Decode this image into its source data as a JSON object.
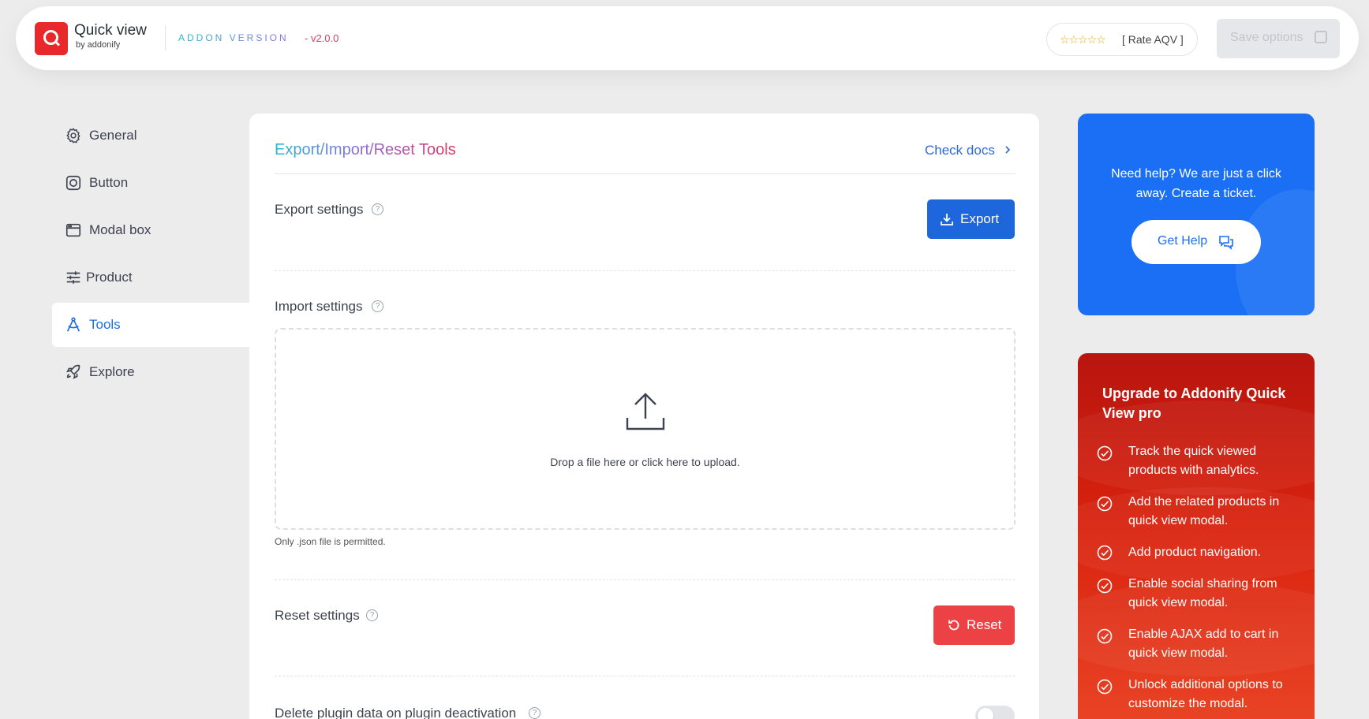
{
  "header": {
    "brand_title": "Quick view",
    "brand_sub": "by addonify",
    "addon_version_label": "ADDON VERSION",
    "version": "- v2.0.0",
    "rate_stars": "☆☆☆☆☆",
    "rate_label": "[ Rate AQV ]",
    "save_label": "Save options"
  },
  "sidebar": {
    "items": [
      {
        "label": "General",
        "icon": "gear-icon",
        "active": false
      },
      {
        "label": "Button",
        "icon": "button-icon",
        "active": false
      },
      {
        "label": "Modal box",
        "icon": "window-icon",
        "active": false
      },
      {
        "label": "Product",
        "icon": "sliders-icon",
        "active": false
      },
      {
        "label": "Tools",
        "icon": "compass-icon",
        "active": true
      },
      {
        "label": "Explore",
        "icon": "rocket-icon",
        "active": false
      }
    ]
  },
  "main": {
    "title": "Export/Import/Reset Tools",
    "check_docs": "Check docs",
    "export": {
      "label": "Export settings",
      "button": "Export"
    },
    "import": {
      "label": "Import settings",
      "drop_text": "Drop a file here or click here to upload.",
      "hint": "Only .json file is permitted."
    },
    "reset": {
      "label": "Reset settings",
      "button": "Reset"
    },
    "delete": {
      "label": "Delete plugin data on plugin deactivation",
      "enabled": false
    }
  },
  "help": {
    "text": "Need help? We are just a click away. Create a ticket.",
    "button": "Get Help"
  },
  "upgrade": {
    "title": "Upgrade to Addonify Quick View pro",
    "features": [
      "Track the quick viewed products with analytics.",
      "Add the related products in quick view modal.",
      "Add product navigation.",
      "Enable social sharing from quick view modal.",
      "Enable AJAX add to cart in quick view modal.",
      "Unlock additional options to customize the modal."
    ]
  },
  "colors": {
    "accent": "#1e66dc",
    "danger": "#ed4245",
    "help_bg": "#1a6ff5",
    "upgrade_bg": "#d9220e"
  }
}
